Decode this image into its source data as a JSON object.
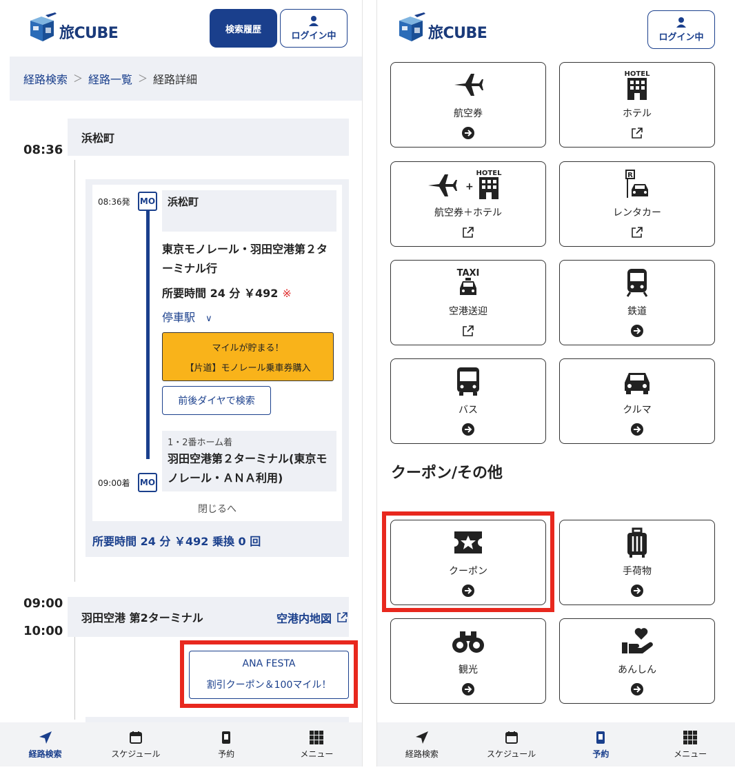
{
  "left": {
    "header": {
      "logo_text": "旅CUBE",
      "history_button": "検索履歴",
      "login_button": "ログイン中"
    },
    "breadcrumb": {
      "items": [
        "経路検索",
        "経路一覧"
      ],
      "current": "経路詳細"
    },
    "times": {
      "start": "08:36",
      "arrive": "09:00",
      "depart": "10:00"
    },
    "stops": {
      "origin": "浜松町",
      "destination": "羽田空港 第2ターミナル"
    },
    "segment": {
      "depart_time": "08:36発",
      "arrive_time": "09:00着",
      "line_badge": "MO",
      "from_station": "浜松町",
      "line_name": "東京モノレール・羽田空港第２ターミナル行",
      "duration": "所要時間 24 分 ￥492",
      "note_mark": "※",
      "stops_label": "停車駅",
      "mile_line1": "マイルが貯まる！",
      "mile_line2": "【片道】モノレール乗車券購入",
      "search_button": "前後ダイヤで検索",
      "platform": "1・2番ホーム着",
      "to_station": "羽田空港第２ターミナル(東京モノレール・ＡＮＡ利用)",
      "close_label": "閉じるへ"
    },
    "summary": "所要時間 24 分 ￥492 乗換 0 回",
    "airport_map": "空港内地図",
    "ana_box": {
      "line1": "ANA FESTA",
      "line2": "割引クーポン＆100マイル！"
    },
    "nav": [
      "経路検索",
      "スケジュール",
      "予約",
      "メニュー"
    ]
  },
  "right": {
    "header": {
      "logo_text": "旅CUBE",
      "login_button": "ログイン中"
    },
    "tiles": [
      {
        "label": "航空券",
        "icon": "plane-icon",
        "action": "arrow"
      },
      {
        "label": "ホテル",
        "icon": "hotel-icon",
        "action": "external"
      },
      {
        "label": "航空券＋ホテル",
        "icon": "plane-hotel-icon",
        "action": "external"
      },
      {
        "label": "レンタカー",
        "icon": "rental-car-icon",
        "action": "external"
      },
      {
        "label": "空港送迎",
        "icon": "taxi-icon",
        "action": "external"
      },
      {
        "label": "鉄道",
        "icon": "train-icon",
        "action": "arrow"
      },
      {
        "label": "バス",
        "icon": "bus-icon",
        "action": "arrow"
      },
      {
        "label": "クルマ",
        "icon": "car-icon",
        "action": "arrow"
      }
    ],
    "section_title": "クーポン/その他",
    "tiles2": [
      {
        "label": "クーポン",
        "icon": "coupon-icon",
        "action": "arrow"
      },
      {
        "label": "手荷物",
        "icon": "luggage-icon",
        "action": "arrow"
      },
      {
        "label": "観光",
        "icon": "binoculars-icon",
        "action": "arrow"
      },
      {
        "label": "あんしん",
        "icon": "care-icon",
        "action": "arrow"
      }
    ],
    "icon_text": {
      "hotel": "HOTEL",
      "taxi": "TAXI",
      "rental_sign": "R",
      "plus": "+"
    },
    "nav": [
      "経路検索",
      "スケジュール",
      "予約",
      "メニュー"
    ]
  },
  "colors": {
    "brand": "#1a3f8c",
    "highlight_red": "#e8281e",
    "mile_yellow": "#f9b31a",
    "panel_gray": "#eef0f5"
  }
}
